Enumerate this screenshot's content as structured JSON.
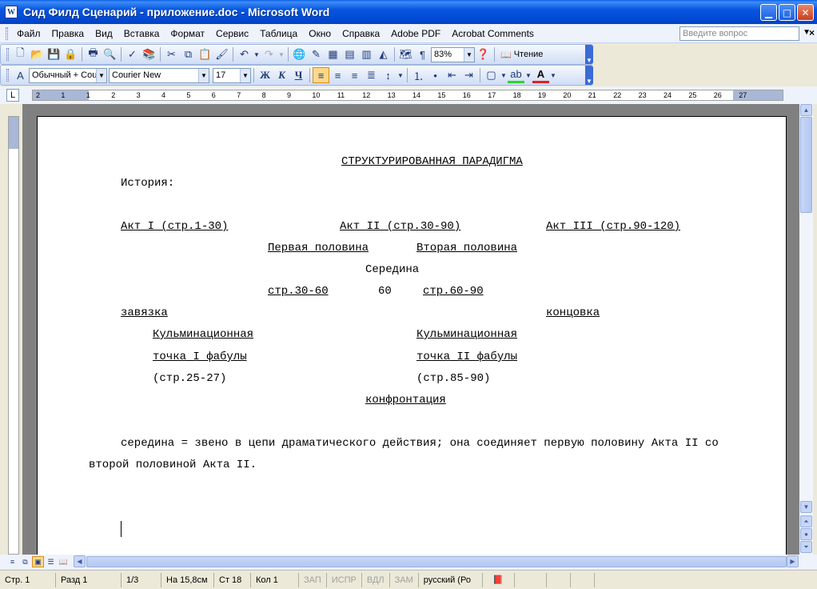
{
  "window": {
    "title": "Сид Филд Сценарий - приложение.doc - Microsoft Word",
    "icon_letter": "W"
  },
  "menu": {
    "items": [
      "Файл",
      "Правка",
      "Вид",
      "Вставка",
      "Формат",
      "Сервис",
      "Таблица",
      "Окно",
      "Справка",
      "Adobe PDF",
      "Acrobat Comments"
    ],
    "ask_placeholder": "Введите вопрос"
  },
  "toolbar": {
    "zoom": "83%",
    "reading_label": "Чтение",
    "style": "Обычный + Cou",
    "font": "Courier New",
    "size": "17"
  },
  "ruler": {
    "labels": [
      "2",
      "1",
      "1",
      "2",
      "3",
      "4",
      "5",
      "6",
      "7",
      "8",
      "9",
      "10",
      "11",
      "12",
      "13",
      "14",
      "15",
      "16",
      "17",
      "18",
      "19",
      "20",
      "21",
      "22",
      "23",
      "24",
      "25",
      "26",
      "27"
    ]
  },
  "document": {
    "title": "СТРУКТУРИРОВАННАЯ ПАРАДИГМА",
    "history": "История:",
    "act1": "Акт I (стр.1-30)",
    "act2": "Акт II (стр.30-90)",
    "act3": "Акт III (стр.90-120)",
    "first_half": "Первая половина",
    "second_half": "Вторая половина ",
    "middle": "Середина",
    "pages_30_60": "стр.30-60",
    "page_60": "60",
    "pages_60_90": "стр.60-90",
    "setup": "завязка",
    "resolution": "концовка",
    "climax1_l1": "Кульминационная",
    "climax1_l2": "точка I фабулы",
    "climax1_l3": "(стр.25-27)",
    "climax2_l1": "Кульминационная",
    "climax2_l2": "точка II фабулы",
    "climax2_l3": "(стр.85-90)",
    "confrontation": "конфронтация",
    "para_line1": "середина = звено в цепи драматического действия; она соединяет первую половину Акта II со",
    "para_line2": "второй половиной Акта II."
  },
  "status": {
    "page": "Стр.  1",
    "section": "Разд  1",
    "pages": "1/3",
    "position": "На 15,8см",
    "line": "Ст  18",
    "col": "Кол  1",
    "rec": "ЗАП",
    "trk": "ИСПР",
    "ext": "ВДЛ",
    "ovr": "ЗАМ",
    "lang": "русский (Ро"
  }
}
